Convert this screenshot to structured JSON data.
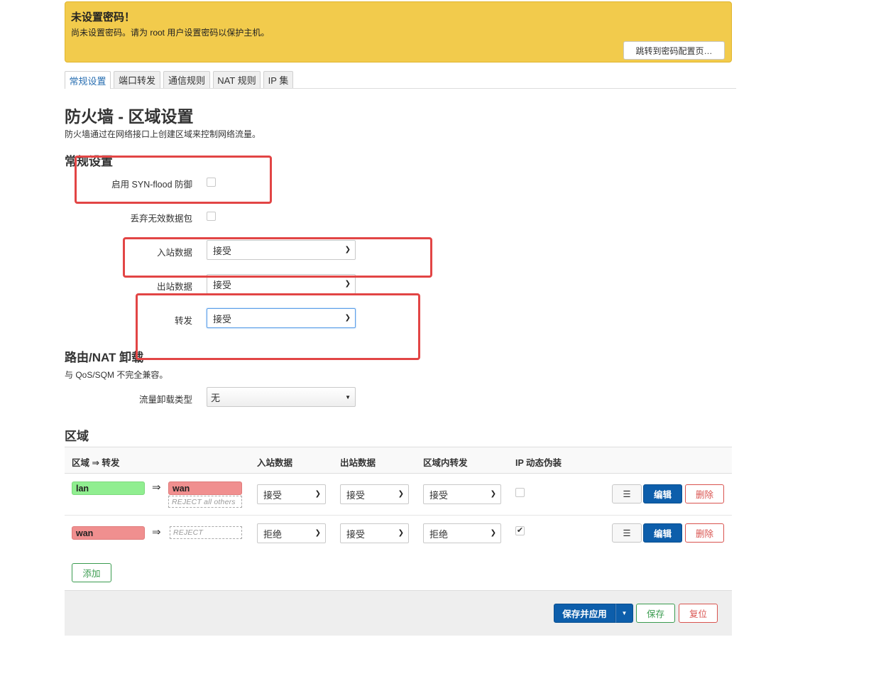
{
  "banner": {
    "title": "未设置密码！",
    "text": "尚未设置密码。请为 root 用户设置密码以保护主机。",
    "button": "跳转到密码配置页…"
  },
  "tabs": [
    "常规设置",
    "端口转发",
    "通信规则",
    "NAT 规则",
    "IP 集"
  ],
  "page": {
    "title": "防火墙 - 区域设置",
    "description": "防火墙通过在网络接口上创建区域来控制网络流量。"
  },
  "general": {
    "heading": "常规设置",
    "syn_flood": "启用 SYN-flood 防御",
    "drop_invalid": "丢弃无效数据包",
    "input_label": "入站数据",
    "input_value": "接受",
    "output_label": "出站数据",
    "output_value": "接受",
    "forward_label": "转发",
    "forward_value": "接受"
  },
  "offload": {
    "heading": "路由/NAT 卸载",
    "description": "与 QoS/SQM 不完全兼容。",
    "type_label": "流量卸载类型",
    "type_value": "无"
  },
  "zones": {
    "heading": "区域",
    "headers": {
      "zone": "区域 ⇒ 转发",
      "input": "入站数据",
      "output": "出站数据",
      "intra": "区域内转发",
      "masq": "IP 动态伪装"
    },
    "arrow": "⇒",
    "rows": [
      {
        "zone": "lan",
        "dest": "wan",
        "dest_note": "REJECT all others",
        "input": "接受",
        "output": "接受",
        "forward": "接受",
        "masq": false
      },
      {
        "zone": "wan",
        "dest_note": "REJECT",
        "input": "拒绝",
        "output": "接受",
        "forward": "拒绝",
        "masq": true
      }
    ],
    "menu_glyph": "☰",
    "edit": "编辑",
    "delete": "删除",
    "add": "添加"
  },
  "footer": {
    "save_apply": "保存并应用",
    "save": "保存",
    "reset": "复位"
  },
  "colors": {
    "banner": "#f2cb4c",
    "primary": "#0d5eab",
    "zone_lan": "#90ee90",
    "zone_wan": "#f08f8f",
    "annotation": "#e24545"
  }
}
